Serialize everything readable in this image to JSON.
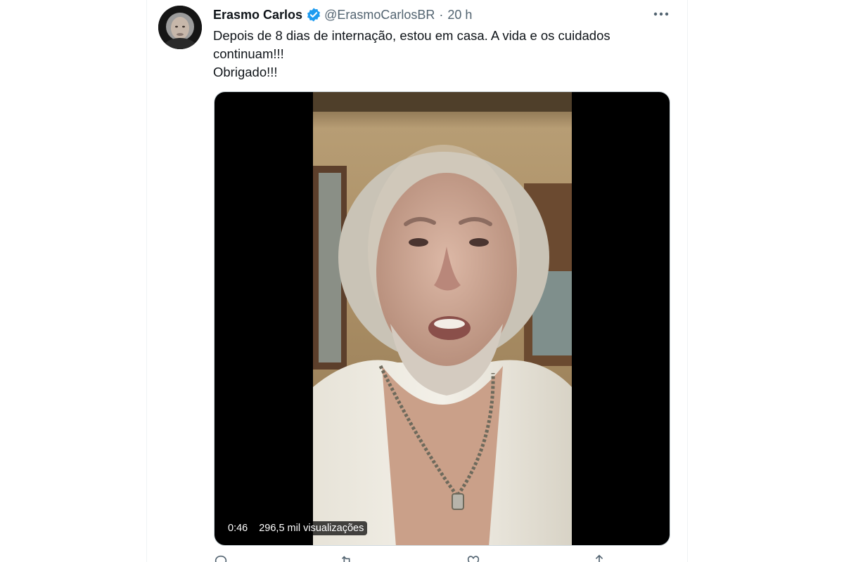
{
  "tweet": {
    "author": {
      "display_name": "Erasmo Carlos",
      "handle": "@ErasmoCarlosBR",
      "verified_icon": "verified-badge-icon"
    },
    "separator": "·",
    "time": "20 h",
    "text_lines": [
      "Depois de 8 dias de internação, estou em casa. A vida e os cuidados continuam!!!",
      "Obrigado!!!"
    ],
    "video": {
      "duration": "0:46",
      "views": "296,5 mil visualizações"
    },
    "actions": [
      "reply-icon",
      "retweet-icon",
      "like-icon",
      "share-icon"
    ]
  },
  "colors": {
    "text_primary": "#0f1419",
    "text_secondary": "#536471",
    "verified_blue": "#1d9bf0",
    "media_background": "#000000"
  }
}
